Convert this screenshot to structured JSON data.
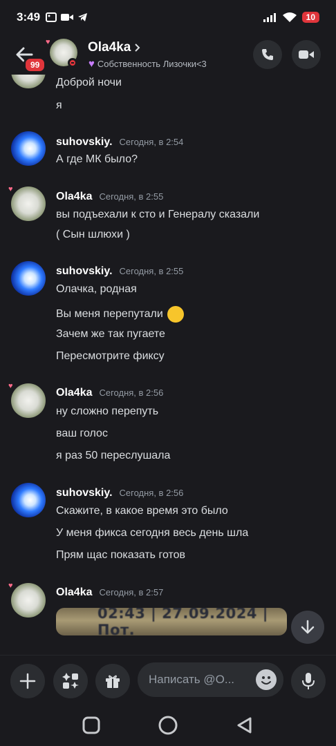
{
  "status_bar": {
    "time": "3:49",
    "battery": "10"
  },
  "header": {
    "unread_badge": "99",
    "name": "Ola4ka",
    "status_text": "Собственность Лизочки<3",
    "status_emoji": "purple-heart"
  },
  "messages": [
    {
      "author": "",
      "lines": [
        "Доброй ночи",
        "я"
      ]
    },
    {
      "author": "suhovskiy.",
      "time": "Сегодня, в 2:54",
      "lines": [
        "А где МК было?"
      ]
    },
    {
      "author": "Ola4ka",
      "time": "Сегодня, в 2:55",
      "lines": [
        "вы подъехали к сто и Генералу сказали",
        "( Сын шлюхи )"
      ]
    },
    {
      "author": "suhovskiy.",
      "time": "Сегодня, в 2:55",
      "lines": [
        "Олачка, родная",
        "Вы меня перепутали",
        "Зачем же так пугаете",
        "Пересмотрите фиксу"
      ]
    },
    {
      "author": "Ola4ka",
      "time": "Сегодня, в 2:56",
      "lines": [
        "ну сложно перепуть",
        "ваш голос",
        "я раз 50 переслушала"
      ]
    },
    {
      "author": "suhovskiy.",
      "time": "Сегодня, в 2:56",
      "lines": [
        "Скажите, в какое время это было",
        "У меня фикса сегодня весь день шла",
        "Прям щас показать готов"
      ]
    },
    {
      "author": "Ola4ka",
      "time": "Сегодня, в 2:57",
      "attachment_text": "02:43 | 27.09.2024 | Пот."
    }
  ],
  "composer": {
    "placeholder": "Написать @O..."
  }
}
